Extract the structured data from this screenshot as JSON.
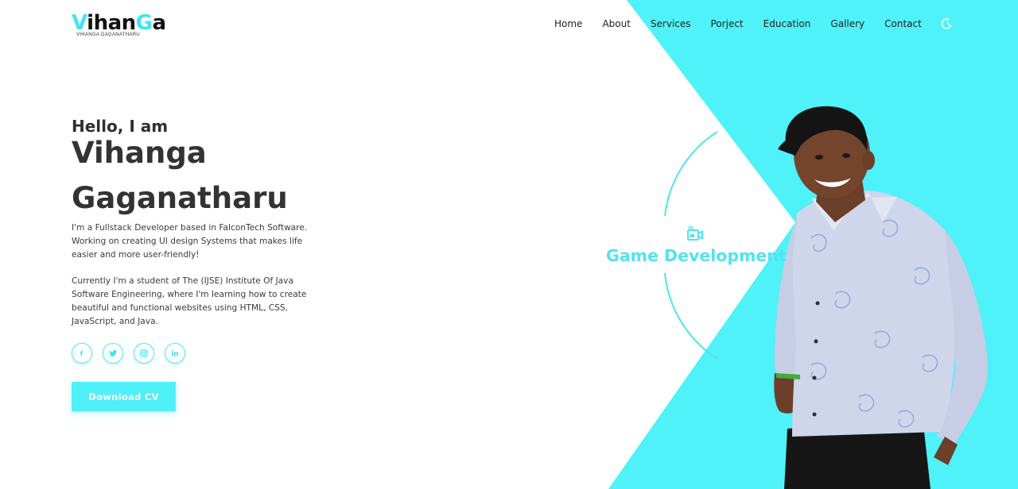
{
  "brand": {
    "logo_main": "Vihan",
    "logo_accent_1": "V",
    "logo_accent_2": "G",
    "logo_text_parts": [
      "V",
      "ihan",
      "G",
      "a"
    ],
    "logo_subtitle": "VIHANGA GAGANATHARU"
  },
  "nav": {
    "items": [
      "Home",
      "About",
      "Services",
      "Porject",
      "Education",
      "Gallery",
      "Contact"
    ],
    "theme_icon": "moon-icon"
  },
  "hero": {
    "greeting": "Hello, I am",
    "first_name": "Vihanga",
    "last_name": "Gaganatharu",
    "description_1": "I'm a Fullstack Developer based in FalconTech Software. Working on creating UI design Systems that makes life easier and more user-friendly!",
    "description_2": "Currently I'm a student of The (IJSE) Institute Of Java Software Engineering, where I'm learning how to create beautiful and functional websites using HTML, CSS, JavaScript, and Java.",
    "socials": [
      "facebook-icon",
      "twitter-icon",
      "instagram-icon",
      "linkedin-icon"
    ],
    "cv_button": "Download CV"
  },
  "service_card": {
    "icon": "video-camera-icon",
    "label": "Game Development"
  },
  "colors": {
    "accent": "#4ff2f8",
    "text_dark": "#2f2f2f",
    "background": "#ffffff"
  }
}
